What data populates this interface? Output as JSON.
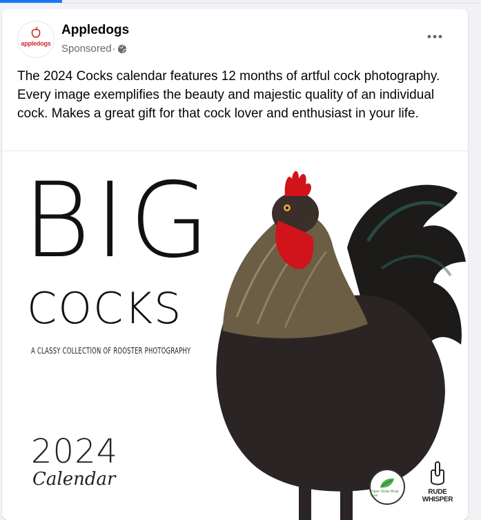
{
  "post": {
    "page_name": "Appledogs",
    "avatar_text": "appledogs",
    "sponsored_label": "Sponsored",
    "separator": "·",
    "more_icon": "more-horizontal-icon",
    "body_text": "The 2024 Cocks calendar features 12 months of artful cock photography. Every image exemplifies the beauty and majestic quality of an individual cock. Makes a great gift for that cock lover and enthusiast in your life."
  },
  "media": {
    "title_big": "BIG",
    "title_cocks": "COCKS",
    "tagline": "A CLASSY COLLECTION OF ROOSTER PHOTOGRAPHY",
    "year": "2024",
    "calendar_word": "Calendar",
    "eco_badge_text": "Paper Straw Wrap Free",
    "brand_badge_text": "RUDE WHISPER"
  },
  "colors": {
    "accent": "#1877f2",
    "brand_red": "#d7252f",
    "text_primary": "#050505",
    "text_secondary": "#65676b"
  }
}
